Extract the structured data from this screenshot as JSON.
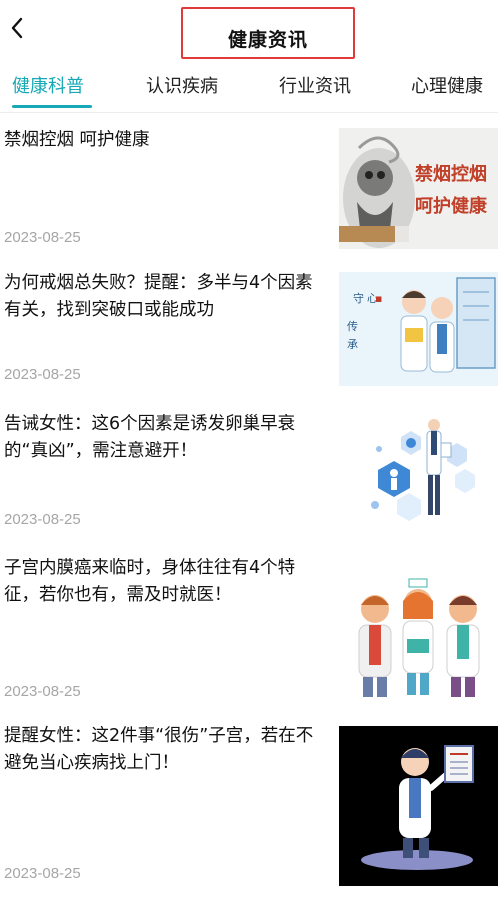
{
  "header": {
    "title": "健康资讯",
    "back_icon": "chevron-left-icon"
  },
  "tabs": [
    {
      "label": "健康科普",
      "active": true
    },
    {
      "label": "认识疾病",
      "active": false
    },
    {
      "label": "行业资讯",
      "active": false
    },
    {
      "label": "心理健康",
      "active": false
    }
  ],
  "colors": {
    "accent": "#17a9b5",
    "highlight_box": "#e03a3a",
    "date_text": "#a6a6a6"
  },
  "articles": [
    {
      "title": "禁烟控烟 呵护健康",
      "date": "2023-08-25",
      "thumb_text": [
        "禁烟控烟",
        "呵护健康"
      ]
    },
    {
      "title": "为何戒烟总失败？提醒：多半与4个因素有关，找到突破口或能成功",
      "date": "2023-08-25"
    },
    {
      "title": "告诫女性：这6个因素是诱发卵巢早衰的“真凶”，需注意避开！",
      "date": "2023-08-25"
    },
    {
      "title": "子宫内膜癌来临时，身体往往有4个特征，若你也有，需及时就医！",
      "date": "2023-08-25"
    },
    {
      "title": "提醒女性：这2件事“很伤”子宫，若在不避免当心疾病找上门！",
      "date": "2023-08-25"
    }
  ]
}
